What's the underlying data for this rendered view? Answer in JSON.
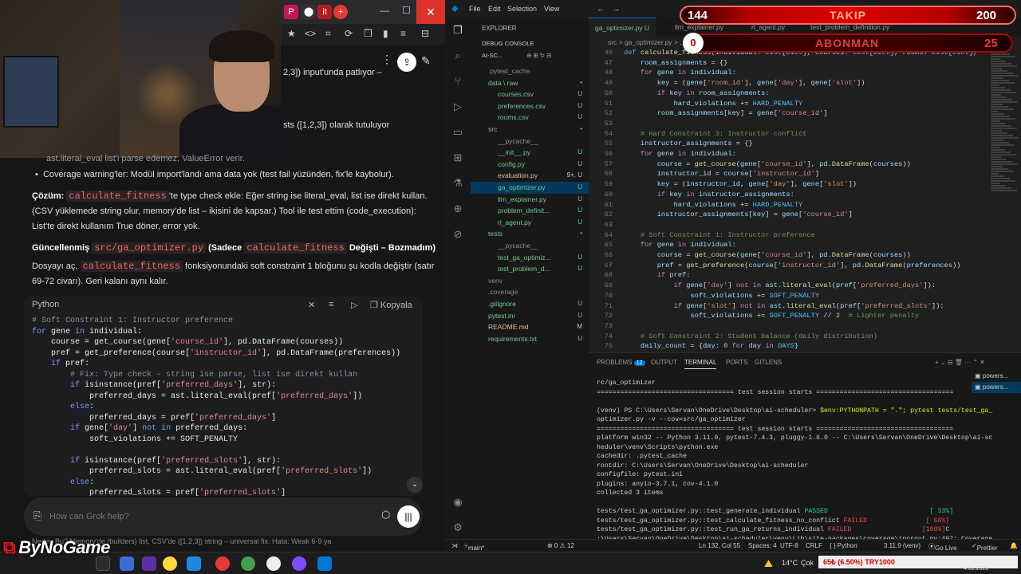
{
  "colors": {
    "accent": "#0078d4",
    "overlay_red": "#d40000",
    "grok_inline_code": "#e46a6a"
  },
  "grok": {
    "partial_lines": [
      "2,3]) input'unda patlıyor –",
      "sts ([1,2,3]) olarak tutuluyor",
      "ast.literal_eval list'i parse edemez, ValueError verir."
    ],
    "bullet_coverage": "Coverage warning'ler: Modül import'landı ama data yok (test fail yüzünden, fix'le kaybolur).",
    "solution_label": "Çözüm:",
    "solution_fn": "calculate_fitness",
    "solution_text_1": "'te type check ekle: Eğer string ise literal_eval, list ise direkt kullan.",
    "solution_text_2": "(CSV yüklemede string olur, memory'de list – ikisini de kapsar.) Tool ile test ettim (code_execution):",
    "solution_text_3": "List'te direkt kullanım True döner, error yok.",
    "updated_label": "Güncellenmiş",
    "updated_file": "src/ga_optimizer.py",
    "updated_paren": "(Sadece",
    "updated_fn": "calculate_fitness",
    "updated_tail": "Değişti – Bozmadım)",
    "open_text_1": "Dosyayı aç,",
    "open_fn": "calculate_fitness",
    "open_text_2": "fonksiyonundaki soft constraint 1 bloğunu şu kodla değiştir (satır",
    "open_text_3": "69-72 civarı). Geri kalanı aynı kalır.",
    "code_lang": "Python",
    "copy_label": "Kopyala",
    "ask_placeholder": "How can Grok help?",
    "bottom_partial": "Neden Bu? Memory'de (builders) list, CSV'de ([1,2,3]) string – universal fix. Hata: Weak 6-9 ya"
  },
  "vscode": {
    "menu": [
      "File",
      "Edit",
      "Selection",
      "View"
    ],
    "explorer_title": "EXPLORER",
    "debug_console": "DEBUG CONSOLE",
    "workspace": "AI-SC...",
    "tree": [
      {
        "name": ".pytest_cache",
        "indent": 1,
        "badge": "",
        "color": "#8b8b8b"
      },
      {
        "name": "data \\ raw",
        "indent": 1,
        "badge": "•",
        "color": "#73c991"
      },
      {
        "name": "courses.csv",
        "indent": 2,
        "badge": "U",
        "color": "#73c991"
      },
      {
        "name": "preferences.csv",
        "indent": 2,
        "badge": "U",
        "color": "#73c991"
      },
      {
        "name": "rooms.csv",
        "indent": 2,
        "badge": "U",
        "color": "#73c991"
      },
      {
        "name": "src",
        "indent": 1,
        "badge": "•",
        "color": "#73c991"
      },
      {
        "name": "__pycache__",
        "indent": 2,
        "badge": "",
        "color": "#8b8b8b"
      },
      {
        "name": "__init__.py",
        "indent": 2,
        "badge": "U",
        "color": "#73c991"
      },
      {
        "name": "config.py",
        "indent": 2,
        "badge": "U",
        "color": "#73c991"
      },
      {
        "name": "evaluation.py",
        "indent": 2,
        "badge": "9+, U",
        "color": "#e2c08d"
      },
      {
        "name": "ga_optimizer.py",
        "indent": 2,
        "badge": "U",
        "color": "#73c991",
        "selected": true
      },
      {
        "name": "llm_explainer.py",
        "indent": 2,
        "badge": "U",
        "color": "#73c991"
      },
      {
        "name": "problem_definit...",
        "indent": 2,
        "badge": "U",
        "color": "#73c991"
      },
      {
        "name": "rl_agent.py",
        "indent": 2,
        "badge": "U",
        "color": "#73c991"
      },
      {
        "name": "tests",
        "indent": 1,
        "badge": "•",
        "color": "#73c991"
      },
      {
        "name": "__pycache__",
        "indent": 2,
        "badge": "",
        "color": "#8b8b8b"
      },
      {
        "name": "test_ga_optimiz...",
        "indent": 2,
        "badge": "U",
        "color": "#73c991"
      },
      {
        "name": "test_problem_d...",
        "indent": 2,
        "badge": "U",
        "color": "#73c991"
      },
      {
        "name": "venv",
        "indent": 1,
        "badge": "",
        "color": "#8b8b8b"
      },
      {
        "name": ".coverage",
        "indent": 1,
        "badge": "",
        "color": "#8b8b8b"
      },
      {
        "name": ".gitignore",
        "indent": 1,
        "badge": "U",
        "color": "#73c991"
      },
      {
        "name": "pytest.ini",
        "indent": 1,
        "badge": "U",
        "color": "#73c991"
      },
      {
        "name": "README.md",
        "indent": 1,
        "badge": "M",
        "color": "#e2c08d"
      },
      {
        "name": "requirements.txt",
        "indent": 1,
        "badge": "U",
        "color": "#73c991"
      }
    ],
    "tabs": [
      {
        "label": "ga_optimizer.py U",
        "active": true
      },
      {
        "label": "llm_explainer.py",
        "active": false
      },
      {
        "label": "rl_agent.py",
        "active": false
      },
      {
        "label": "test_problem_definition.py",
        "active": false
      }
    ],
    "breadcrumb": "src > ga_optimizer.py > ...",
    "panel_tabs": [
      "PROBLEMS",
      "OUTPUT",
      "TERMINAL",
      "PORTS",
      "GITLENS"
    ],
    "problems_count": "12",
    "terminals": [
      "powers...",
      "powers..."
    ],
    "status": {
      "branch": "main*",
      "errors": "⊗ 0 ⚠ 12",
      "position": "Ln 132, Col 55",
      "spaces": "Spaces: 4",
      "encoding": "UTF-8",
      "eol": "CRLF",
      "language": "{ } Python",
      "python": "3.11.9 (venv)",
      "golive": "Go Live",
      "prettier": "Prettier"
    }
  },
  "overlay": {
    "takip_label": "TAKIP",
    "takip_current": "144",
    "takip_goal": "200",
    "abone_label": "ABONMAN",
    "abone_current": "0",
    "abone_goal": "25"
  },
  "taskbar": {
    "logo": "ByNoGame",
    "weather": "14°C",
    "weather_desc": "Çok",
    "ticker": "65₺ (6.50%) TRY1000",
    "date": "4.01.2026"
  }
}
